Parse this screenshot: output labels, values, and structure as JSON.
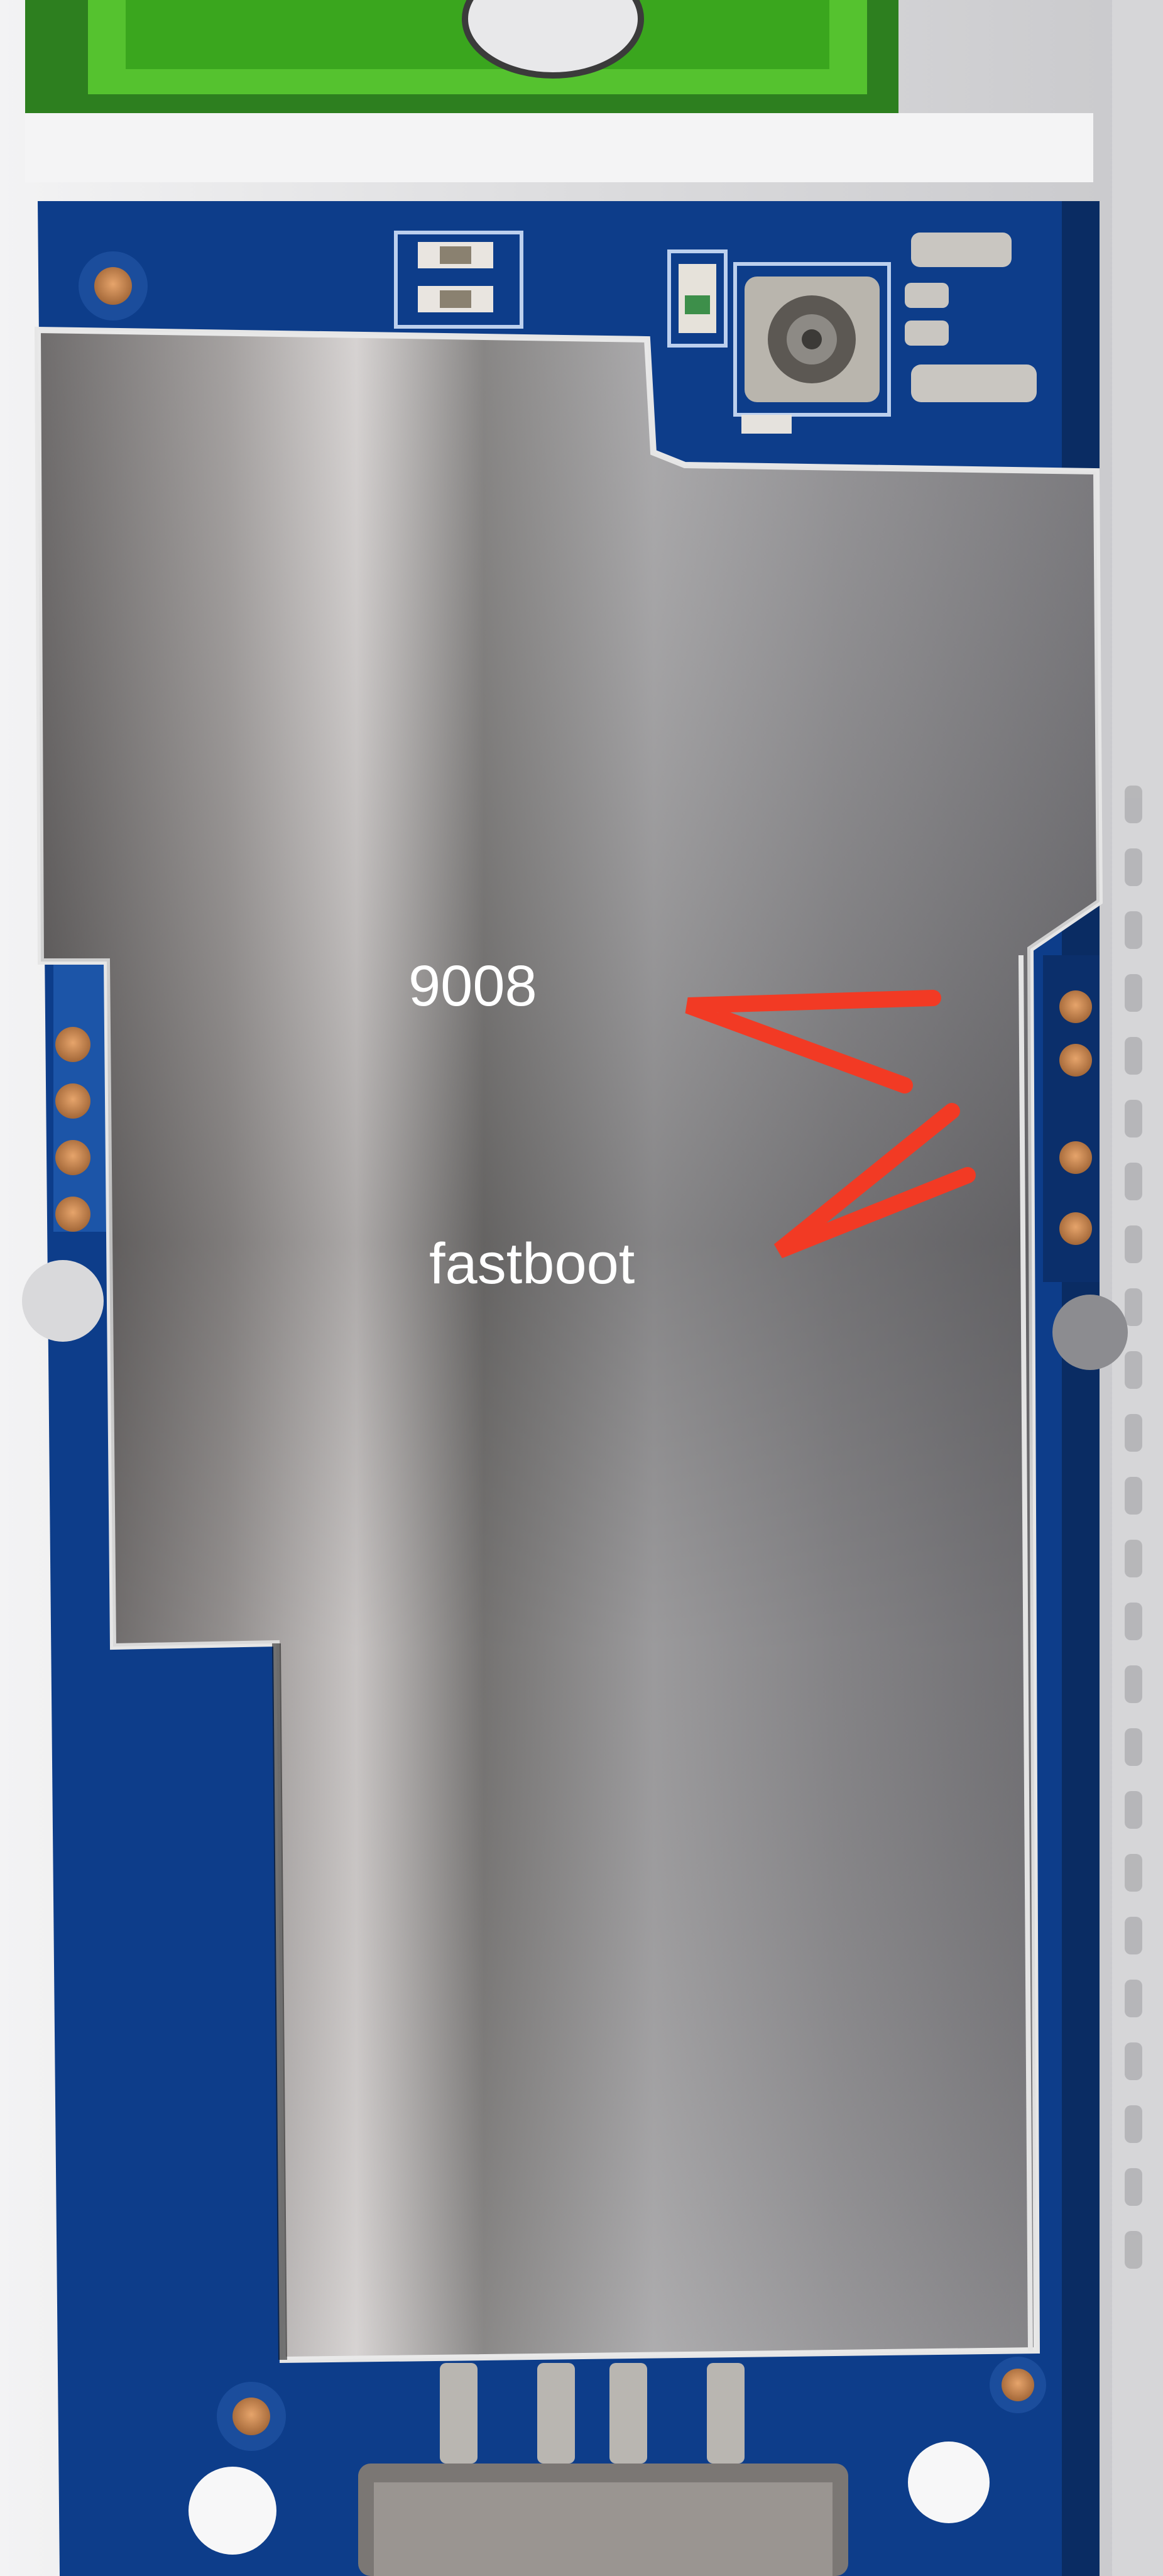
{
  "annotations": {
    "label_9008": "9008",
    "label_fastboot": "fastboot"
  },
  "colors": {
    "pcb_blue": "#0c3e8c",
    "shield_metal": "#8f8f92",
    "arrow_red": "#f23a24",
    "connector_green": "#4cb82b",
    "housing_white": "#ececee",
    "copper_pad": "#c98a52"
  },
  "objects": [
    "pcb-board",
    "metal-shield-can",
    "u-fl-antenna-connector",
    "usb-connector",
    "status-leds",
    "test-pads-left",
    "test-pads-right",
    "red-pointer-arrows"
  ]
}
